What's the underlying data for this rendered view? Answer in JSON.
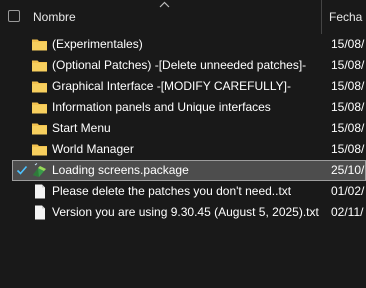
{
  "header": {
    "name_label": "Nombre",
    "date_label": "Fecha"
  },
  "rows": [
    {
      "label": "(Experimentales)",
      "date": "15/08/",
      "type": "folder",
      "selected": false
    },
    {
      "label": "(Optional Patches)  -[Delete unneeded patches]-",
      "date": "15/08/",
      "type": "folder",
      "selected": false
    },
    {
      "label": "Graphical Interface  -[MODIFY CAREFULLY]-",
      "date": "15/08/",
      "type": "folder",
      "selected": false
    },
    {
      "label": "Information panels and Unique interfaces",
      "date": "15/08/",
      "type": "folder",
      "selected": false
    },
    {
      "label": "Start Menu",
      "date": "15/08/",
      "type": "folder",
      "selected": false
    },
    {
      "label": "World Manager",
      "date": "15/08/",
      "type": "folder",
      "selected": false
    },
    {
      "label": "Loading screens.package",
      "date": "25/10/",
      "type": "package",
      "selected": true
    },
    {
      "label": "Please delete the patches you don't need..txt",
      "date": "01/02/",
      "type": "text",
      "selected": false
    },
    {
      "label": "Version you are using 9.30.45 (August 5, 2025).txt",
      "date": "02/11/",
      "type": "text",
      "selected": false
    }
  ],
  "colors": {
    "background": "#191919",
    "selected_row": "#4d4d4d",
    "folder": "#f2c14e",
    "check_accent": "#4cc2ff"
  }
}
